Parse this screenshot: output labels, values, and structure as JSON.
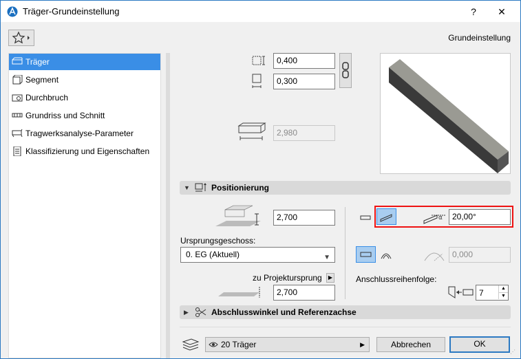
{
  "window": {
    "title": "Träger-Grundeinstellung",
    "help_label": "?",
    "close_label": "✕"
  },
  "header": {
    "section_title": "Grundeinstellung"
  },
  "tree": {
    "items": [
      {
        "label": "Träger",
        "icon": "beam-icon",
        "selected": true
      },
      {
        "label": "Segment",
        "icon": "segment-icon",
        "selected": false
      },
      {
        "label": "Durchbruch",
        "icon": "opening-icon",
        "selected": false
      },
      {
        "label": "Grundriss und Schnitt",
        "icon": "floorplan-section-icon",
        "selected": false
      },
      {
        "label": "Tragwerksanalyse-Parameter",
        "icon": "structural-analysis-icon",
        "selected": false
      },
      {
        "label": "Klassifizierung und Eigenschaften",
        "icon": "classification-icon",
        "selected": false
      }
    ]
  },
  "geometry": {
    "width_value": "0,400",
    "height_value": "0,300",
    "length_value": "2,980"
  },
  "positioning": {
    "header_label": "Positionierung",
    "elevation_value": "2,700",
    "home_story_label": "Ursprungsgeschoss:",
    "home_story_value": "0. EG (Aktuell)",
    "project_zero_label": "zu Projektursprung",
    "project_zero_value": "2,700",
    "slant_angle_value": "20,00°",
    "curve_value": "0,000",
    "connection_order_label": "Anschlussreihenfolge:",
    "connection_order_value": "7"
  },
  "end_cuts": {
    "header_label": "Abschlusswinkel und Referenzachse"
  },
  "footer": {
    "layer_label": "20 Träger",
    "cancel_label": "Abbrechen",
    "ok_label": "OK"
  },
  "colors": {
    "accent": "#3a8ee6",
    "highlight_box": "#ee1111"
  }
}
